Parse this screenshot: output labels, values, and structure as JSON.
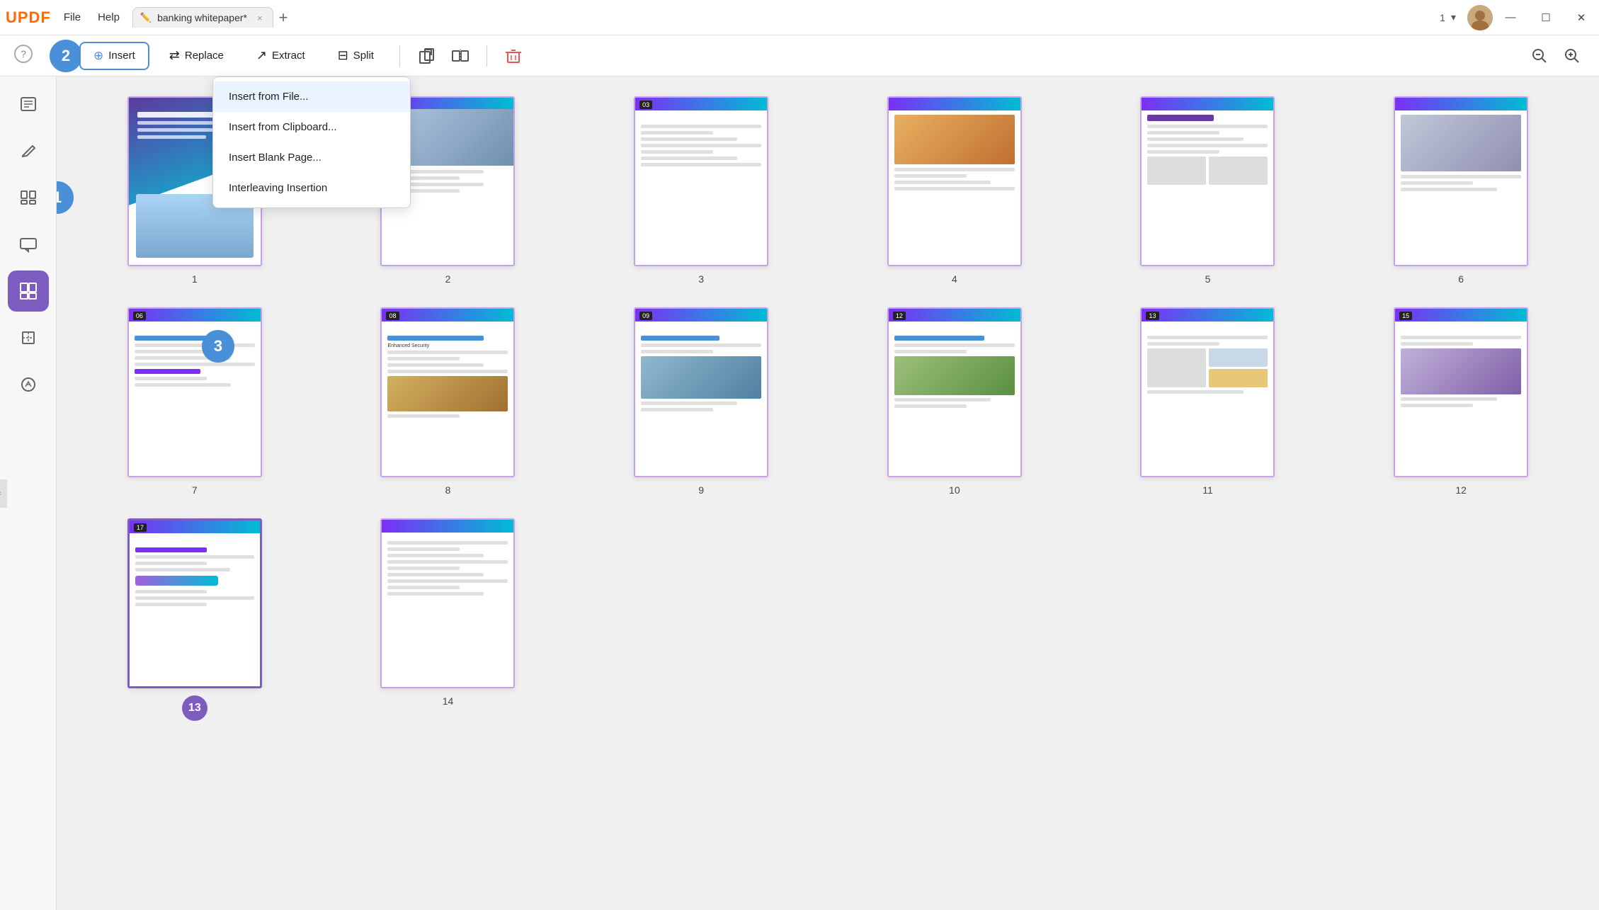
{
  "app": {
    "logo": "UPDF",
    "menu": [
      "File",
      "Help"
    ],
    "tab": {
      "icon": "✏",
      "title": "banking whitepaper*",
      "close": "×"
    },
    "tab_add": "+",
    "page_count": "1",
    "win_controls": [
      "—",
      "☐",
      "×"
    ]
  },
  "toolbar": {
    "help_icon": "?",
    "step2_label": "2",
    "insert_label": "Insert",
    "replace_label": "Replace",
    "extract_label": "Extract",
    "split_label": "Split",
    "icon1": "⊞",
    "icon2": "⊟",
    "delete_icon": "🗑",
    "zoom_out_label": "🔍",
    "zoom_in_label": "🔍"
  },
  "dropdown": {
    "items": [
      {
        "label": "Insert from File...",
        "active": true
      },
      {
        "label": "Insert from Clipboard..."
      },
      {
        "label": "Insert Blank Page..."
      },
      {
        "label": "Interleaving Insertion"
      }
    ]
  },
  "sidebar": {
    "items": [
      {
        "icon": "📋",
        "label": "",
        "active": false
      },
      {
        "icon": "✏",
        "label": "",
        "active": false
      },
      {
        "icon": "☰",
        "label": "",
        "active": false
      },
      {
        "icon": "⊞",
        "label": "",
        "active": false
      },
      {
        "icon": "📄",
        "label": "",
        "active": true
      },
      {
        "icon": "⊟",
        "label": "",
        "active": false
      },
      {
        "icon": "◎",
        "label": "",
        "active": false
      }
    ]
  },
  "pages": [
    {
      "num": 1,
      "label": "1",
      "type": "cover"
    },
    {
      "num": 2,
      "label": "2",
      "type": "photo"
    },
    {
      "num": 3,
      "label": "3",
      "type": "text"
    },
    {
      "num": 4,
      "label": "4",
      "type": "text"
    },
    {
      "num": 5,
      "label": "5",
      "type": "text"
    },
    {
      "num": 6,
      "label": "6",
      "type": "text"
    },
    {
      "num": 7,
      "label": "7",
      "type": "text"
    },
    {
      "num": 8,
      "label": "8",
      "type": "enhanced",
      "title": "Enhanced Security"
    },
    {
      "num": 9,
      "label": "9",
      "type": "text"
    },
    {
      "num": 10,
      "label": "10",
      "type": "text"
    },
    {
      "num": 11,
      "label": "11",
      "type": "text"
    },
    {
      "num": 12,
      "label": "12",
      "type": "text"
    },
    {
      "num": 13,
      "label": "",
      "type": "text",
      "selected": true
    },
    {
      "num": 14,
      "label": "14",
      "type": "text"
    }
  ],
  "steps": {
    "step1": "1",
    "step2": "2",
    "step3": "3"
  },
  "colors": {
    "accent_purple": "#7c5cbf",
    "accent_blue": "#4a90d9",
    "toolbar_border": "#4a90d9"
  }
}
